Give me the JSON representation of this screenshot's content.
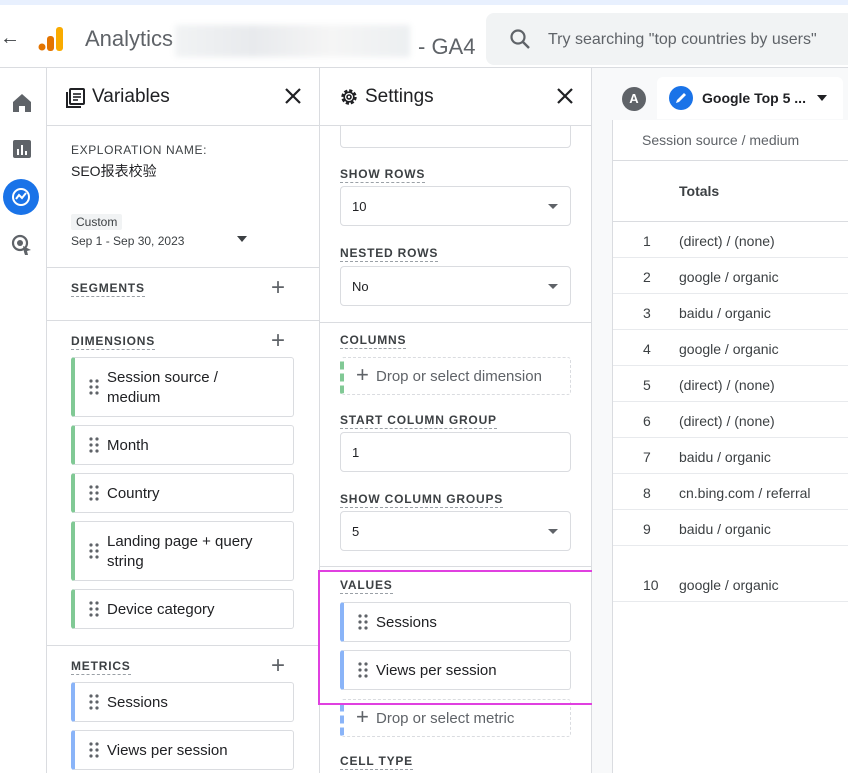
{
  "topbar": {
    "app_name": "Analytics",
    "property_suffix": "- GA4",
    "search_placeholder": "Try searching \"top countries by users\""
  },
  "variables": {
    "title": "Variables",
    "exploration_label": "EXPLORATION NAME:",
    "exploration_name": "SEO报表校验",
    "date_badge": "Custom",
    "date_range": "Sep 1 - Sep 30, 2023",
    "segments_label": "SEGMENTS",
    "dimensions_label": "DIMENSIONS",
    "dimensions": [
      {
        "line1": "Session source /",
        "line2": "medium"
      },
      {
        "line1": "Month",
        "line2": ""
      },
      {
        "line1": "Country",
        "line2": ""
      },
      {
        "line1": "Landing page + query",
        "line2": "string"
      },
      {
        "line1": "Device category",
        "line2": ""
      }
    ],
    "metrics_label": "METRICS",
    "metrics": [
      "Sessions",
      "Views per session"
    ]
  },
  "settings": {
    "title": "Settings",
    "show_rows_label": "SHOW ROWS",
    "show_rows_value": "10",
    "nested_rows_label": "NESTED ROWS",
    "nested_rows_value": "No",
    "columns_label": "COLUMNS",
    "drop_dimension": "Drop or select dimension",
    "start_column_group_label": "START COLUMN GROUP",
    "start_column_group_value": "1",
    "show_column_groups_label": "SHOW COLUMN GROUPS",
    "show_column_groups_value": "5",
    "values_label": "VALUES",
    "values": [
      "Sessions",
      "Views per session"
    ],
    "drop_metric": "Drop or select metric",
    "cell_type_label": "CELL TYPE"
  },
  "report": {
    "avatar_letter": "A",
    "tab_title": "Google Top 5 ...",
    "column_header": "Session source / medium",
    "totals_label": "Totals",
    "rows": [
      {
        "n": "1",
        "v": "(direct) / (none)"
      },
      {
        "n": "2",
        "v": "google / organic"
      },
      {
        "n": "3",
        "v": "baidu / organic"
      },
      {
        "n": "4",
        "v": "google / organic"
      },
      {
        "n": "5",
        "v": "(direct) / (none)"
      },
      {
        "n": "6",
        "v": "(direct) / (none)"
      },
      {
        "n": "7",
        "v": "baidu / organic"
      },
      {
        "n": "8",
        "v": "cn.bing.com / referral"
      },
      {
        "n": "9",
        "v": "baidu / organic"
      },
      {
        "n": "10",
        "v": "google / organic"
      }
    ]
  },
  "colors": {
    "accent": "#1a73e8",
    "dimension_bar": "#81c995",
    "metric_bar": "#8ab4f8",
    "highlight": "#e040e0"
  }
}
